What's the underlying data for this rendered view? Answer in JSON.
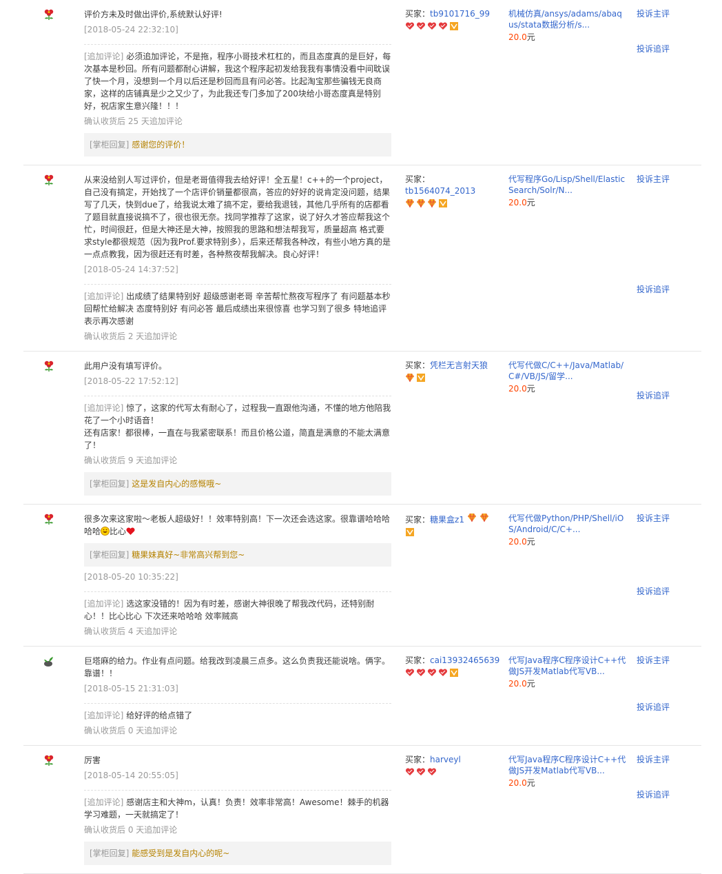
{
  "labels": {
    "buyer": "买家：",
    "append_tag": "[追加评论]",
    "reply_tag": "[掌柜回复]",
    "complain_main": "投诉主评",
    "complain_append": "投诉追评",
    "currency": "元"
  },
  "reviews": [
    {
      "rating_icon": "red-flower-icon",
      "text": "评价方未及时做出评价,系统默认好评!",
      "date": "[2018-05-24 22:32:10]",
      "append": "必须追加评论，不是拖，程序小哥技术杠杠的，而且态度真的是巨好，每次基本是秒回。所有问题都耐心讲解，我这个程序起初发给我我有事情没看中间耽误了快一个月，没想到一个月以后还是秒回而且有问必答。比起淘宝那些骗钱无良商家，这样的店铺真是少之又少了，为此我还专门多加了200块给小哥态度真是特别好，祝店家生意兴隆！！！",
      "append_meta": "确认收货后 25 天追加评论",
      "reply_after_append": "感谢您的评价！",
      "buyer_name": "tb9101716_99",
      "badges": [
        "heart-icon",
        "heart-icon",
        "heart-icon",
        "heart-icon",
        "vip-icon"
      ],
      "item_title": "机械仿真/ansys/adams/abaqus/stata数据分析/s...",
      "price": "20.0"
    },
    {
      "rating_icon": "red-flower-icon",
      "text": "从来没给别人写过评价，但是老哥值得我去给好评！全五星！c++的一个project，自己没有搞定，开始找了一个店评价销量都很高，答应的好好的说肯定没问题，结果写了几天，快到due了，给我说太难了搞不定，要给我退钱，其他几乎所有的店都看了题目就直接说搞不了，很也很无奈。找同学推荐了这家，说了好久才答应帮我这个忙，时间很赶，但是大神还是大神，按照我的思路和想法帮我写，质量超高 格式要求style都很规范（因为我Prof.要求特别多），后来还帮我各种改，有些小地方真的是一点点教我，因为很赶还有时差，各种熬夜帮我解决。良心好评！",
      "date": "[2018-05-24 14:37:52]",
      "append": "出成绩了结果特别好 超级感谢老哥 辛苦帮忙熬夜写程序了 有问题基本秒回帮忙给解决 态度特别好 有问必答 最后成绩出来很惊喜 也学习到了很多 特地追评表示再次感谢",
      "append_meta": "确认收货后 2 天追加评论",
      "buyer_name": "tb1564074_2013",
      "badges": [
        "diamond-icon",
        "diamond-icon",
        "diamond-icon",
        "vip-icon"
      ],
      "item_title": "代写程序Go/Lisp/Shell/Elastic Search/Solr/N...",
      "price": "20.0"
    },
    {
      "rating_icon": "red-flower-icon",
      "text": "此用户没有填写评价。",
      "date": "[2018-05-22 17:52:12]",
      "append": "惊了，这家的代写太有耐心了，过程我一直跟他沟通，不懂的地方他陪我花了一个小时语音！\n还有店家！都很棒，一直在与我紧密联系！而且价格公道，简直是满意的不能太满意了！",
      "append_meta": "确认收货后 9 天追加评论",
      "reply_after_append": "这是发自内心的感慨哦~",
      "buyer_name": "凭栏无言射天狼",
      "badges": [
        "diamond-icon",
        "vip-icon"
      ],
      "item_title": "代写代做C/C++/Java/Matlab/C#/VB/JS/留学...",
      "price": "20.0"
    },
    {
      "rating_icon": "red-flower-icon",
      "text": "很多次来这家啦～老板人超级好！！效率特别高！下一次还会选这家。很靠谱哈哈哈哈哈",
      "text_suffix": "比心",
      "reply_after_text": "糖果妹真好~非常高兴帮到您~",
      "date": "[2018-05-20 10:35:22]",
      "append": "选这家没错的！因为有时差，感谢大神很晚了帮我改代码，还特别耐心！！比心比心 下次还来哈哈哈 效率贼高",
      "append_meta": "确认收货后 4 天追加评论",
      "buyer_name": "糖果盒z1",
      "badges": [
        "diamond-icon",
        "diamond-icon",
        "vip-icon"
      ],
      "item_title": "代写代做Python/PHP/Shell/iOS/Android/C/C+...",
      "price": "20.0"
    },
    {
      "rating_icon": "green-plant-icon",
      "text": "巨塔麻的给力。作业有点问题。给我改到凌晨三点多。这么负责我还能说啥。俩字。靠谱！！",
      "date": "[2018-05-15 21:31:03]",
      "append": "给好评的给点错了",
      "append_meta": "确认收货后 0 天追加评论",
      "buyer_name": "cai13932465639",
      "badges": [
        "heart-icon",
        "heart-icon",
        "heart-icon",
        "heart-icon",
        "vip-icon"
      ],
      "item_title": "代写Java程序C程序设计C++代做JS开发Matlab代写VB...",
      "price": "20.0"
    },
    {
      "rating_icon": "red-flower-icon",
      "text": "厉害",
      "date": "[2018-05-14 20:55:05]",
      "append": "感谢店主和大神m，认真！负责！效率非常高！Awesome！棘手的机器学习难题，一天就搞定了！",
      "append_meta": "确认收货后 0 天追加评论",
      "reply_after_append": "能感受到是发自内心的呢~",
      "buyer_name": "harveyl",
      "badges": [
        "heart-icon",
        "heart-icon",
        "heart-icon"
      ],
      "item_title": "代写Java程序C程序设计C++代做JS开发Matlab代写VB...",
      "price": "20.0"
    }
  ]
}
